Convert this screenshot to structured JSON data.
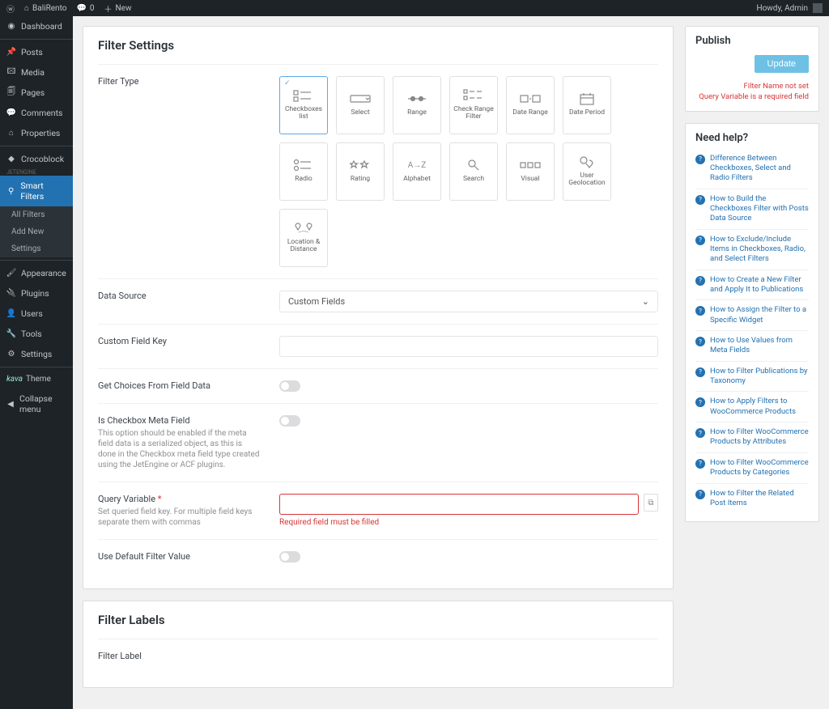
{
  "adminbar": {
    "site": "BaliRento",
    "comments": "0",
    "new": "New",
    "howdy": "Howdy, Admin"
  },
  "sidebar": {
    "dashboard": "Dashboard",
    "posts": "Posts",
    "media": "Media",
    "pages": "Pages",
    "comments": "Comments",
    "properties": "Properties",
    "crocoblock": "Crocoblock",
    "smartfilters": "Smart Filters",
    "sub": {
      "all": "All Filters",
      "add": "Add New",
      "settings": "Settings"
    },
    "appearance": "Appearance",
    "plugins": "Plugins",
    "users": "Users",
    "tools": "Tools",
    "settings": "Settings",
    "theme_prefix": "kava",
    "theme": "Theme",
    "collapse": "Collapse menu"
  },
  "panel": {
    "settings_title": "Filter Settings",
    "labels_title": "Filter Labels",
    "filter_label": "Filter Label"
  },
  "labels": {
    "filter_type": "Filter Type",
    "data_source": "Data Source",
    "custom_field_key": "Custom Field Key",
    "get_choices": "Get Choices From Field Data",
    "is_checkbox": "Is Checkbox Meta Field",
    "is_checkbox_desc": "This option should be enabled if the meta field data is a serialized object, as this is done in the Checkbox meta field type created using the JetEngine or ACF plugins.",
    "query_var": "Query Variable",
    "query_var_desc": "Set queried field key. For multiple field keys separate them with commas",
    "query_var_err": "Required field must be filled",
    "use_default": "Use Default Filter Value"
  },
  "types": [
    {
      "id": "checkboxes",
      "label": "Checkboxes list"
    },
    {
      "id": "select",
      "label": "Select"
    },
    {
      "id": "range",
      "label": "Range"
    },
    {
      "id": "check-range",
      "label": "Check Range Filter"
    },
    {
      "id": "date-range",
      "label": "Date Range"
    },
    {
      "id": "date-period",
      "label": "Date Period"
    },
    {
      "id": "radio",
      "label": "Radio"
    },
    {
      "id": "rating",
      "label": "Rating"
    },
    {
      "id": "alphabet",
      "label": "Alphabet"
    },
    {
      "id": "search",
      "label": "Search"
    },
    {
      "id": "visual",
      "label": "Visual"
    },
    {
      "id": "geolocation",
      "label": "User Geolocation"
    },
    {
      "id": "distance",
      "label": "Location & Distance"
    }
  ],
  "data_source_value": "Custom Fields",
  "publish": {
    "title": "Publish",
    "update": "Update",
    "err1": "Filter Name not set",
    "err2": "Query Variable is a required field"
  },
  "help": {
    "title": "Need help?",
    "items": [
      "Difference Between Checkboxes, Select and Radio Filters",
      "How to Build the Checkboxes Filter with Posts Data Source",
      "How to Exclude/Include Items in Checkboxes, Radio, and Select Filters",
      "How to Create a New Filter and Apply It to Publications",
      "How to Assign the Filter to a Specific Widget",
      "How to Use Values from Meta Fields",
      "How to Filter Publications by Taxonomy",
      "How to Apply Filters to WooCommerce Products",
      "How to Filter WooCommerce Products by Attributes",
      "How to Filter WooCommerce Products by Categories",
      "How to Filter the Related Post Items"
    ]
  }
}
